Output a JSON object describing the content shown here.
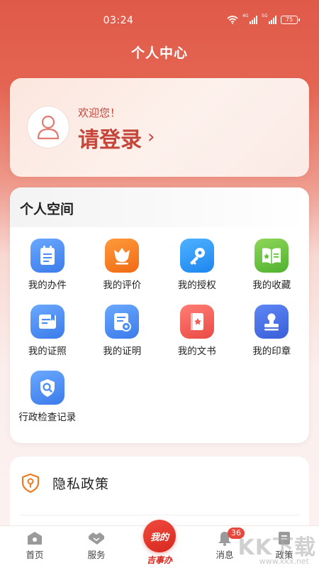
{
  "status_bar": {
    "time": "03:24",
    "net1": "4G",
    "net2": "5G",
    "battery": "75"
  },
  "page_title": "个人中心",
  "login": {
    "welcome": "欢迎您！",
    "action": "请登录",
    "chevron": "›"
  },
  "personal_space": {
    "title": "个人空间",
    "items": [
      {
        "label": "我的办件",
        "icon": "document-list-icon",
        "color": "#4a8cf5"
      },
      {
        "label": "我的评价",
        "icon": "tulip-icon",
        "color": "#f57a22"
      },
      {
        "label": "我的授权",
        "icon": "key-icon",
        "color": "#2a92f2"
      },
      {
        "label": "我的收藏",
        "icon": "open-book-star-icon",
        "color": "#62c03a"
      },
      {
        "label": "我的证照",
        "icon": "license-card-icon",
        "color": "#4a8cf5"
      },
      {
        "label": "我的证明",
        "icon": "certificate-icon",
        "color": "#4a8cf5"
      },
      {
        "label": "我的文书",
        "icon": "folder-star-icon",
        "color": "#f05c55"
      },
      {
        "label": "我的印章",
        "icon": "stamp-icon",
        "color": "#4a6fe6"
      },
      {
        "label": "行政检查记录",
        "icon": "shield-search-icon",
        "color": "#4a8cf5"
      }
    ]
  },
  "privacy": {
    "label": "隐私政策",
    "icon": "shield-location-icon",
    "color": "#f07a22"
  },
  "bottom_nav": {
    "home": "首页",
    "service": "服务",
    "mine": "我的",
    "brand": "吉事办",
    "messages": "消息",
    "messages_badge": "36",
    "policy": "政策"
  },
  "watermark": {
    "text": "KK下载",
    "url": "www.kkx.net"
  },
  "colors": {
    "accent": "#d7281f",
    "header": "#e05a48"
  }
}
